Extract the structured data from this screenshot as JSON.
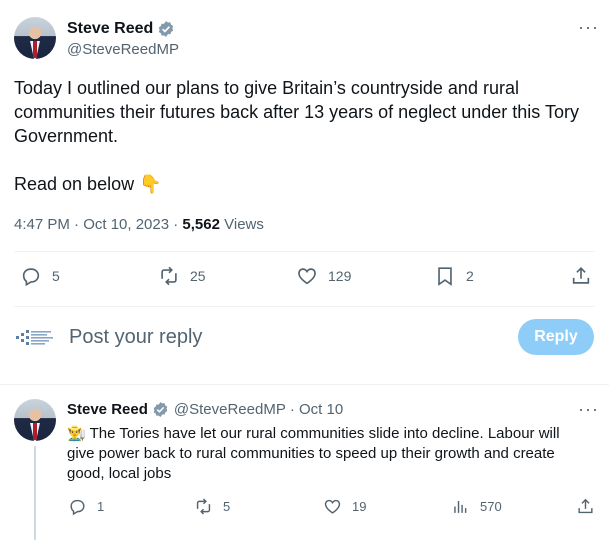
{
  "main_tweet": {
    "author_name": "Steve Reed",
    "author_handle": "@SteveReedMP",
    "text_line1": "Today I outlined our plans to give Britain’s countryside and rural communities their futures back after 13 years of neglect under this Tory Government.",
    "text_line2": "Read on below 👇",
    "time": "4:47 PM · Oct 10, 2023 · ",
    "views_count": "5,562",
    "views_label": " Views",
    "actions": {
      "replies": "5",
      "reposts": "25",
      "likes": "129",
      "bookmarks": "2"
    }
  },
  "composer": {
    "placeholder": "Post your reply",
    "reply_label": "Reply"
  },
  "reply_tweet": {
    "author_name": "Steve Reed",
    "author_handle": "@SteveReedMP",
    "date": "· Oct 10",
    "emoji": "👨‍🌾",
    "text": "The Tories have let our rural communities slide into decline. Labour will give power back to rural communities to speed up their growth and create good, local jobs",
    "actions": {
      "replies": "1",
      "reposts": "5",
      "likes": "19",
      "views": "570"
    }
  },
  "colors": {
    "accent": "#1d9bf0",
    "reply_button": "#8ecdf8",
    "muted": "#536471"
  }
}
